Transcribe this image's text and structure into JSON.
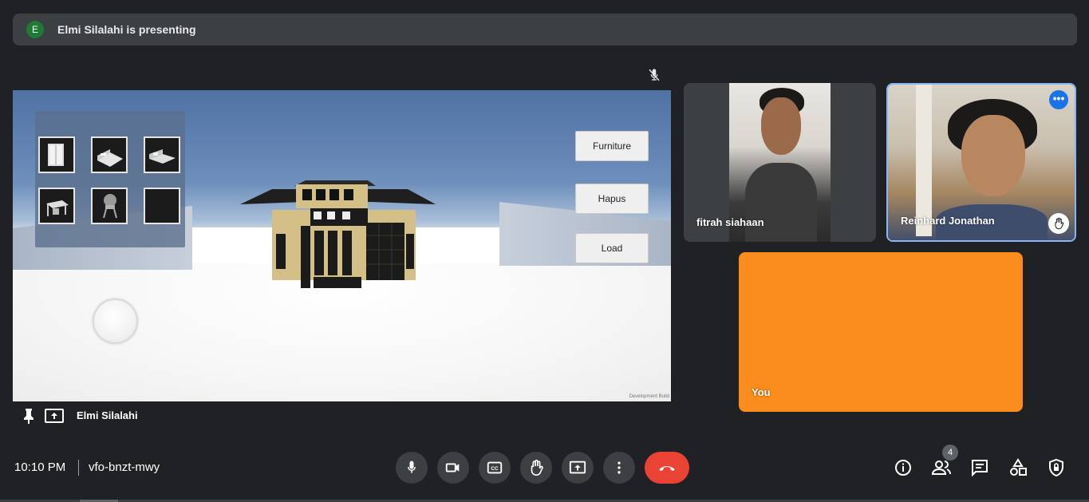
{
  "presenting_bar": {
    "avatar_initial": "E",
    "text": "Elmi Silalahi is presenting"
  },
  "stage": {
    "buttons": {
      "furniture": "Furniture",
      "hapus": "Hapus",
      "load": "Load"
    },
    "watermark": "Development Build",
    "presenter_name": "Elmi Silalahi"
  },
  "participants": [
    {
      "name": "fitrah siahaan"
    },
    {
      "name": "Reinhard Jonathan",
      "hand_raised": true
    },
    {
      "name": "You"
    }
  ],
  "bottom_bar": {
    "time": "10:10 PM",
    "meeting_code": "vfo-bnzt-mwy",
    "people_count": "4"
  },
  "colors": {
    "background": "#202124",
    "tile": "#3c4043",
    "you_tile": "#fa8c1e",
    "end_call": "#ea4335",
    "accent": "#1a73e8"
  },
  "icons": [
    "mic-icon",
    "camera-icon",
    "captions-icon",
    "raise-hand-icon",
    "present-screen-icon",
    "more-options-icon",
    "end-call-icon",
    "info-icon",
    "people-icon",
    "chat-icon",
    "activities-icon",
    "host-controls-icon",
    "pin-icon",
    "mic-off-icon"
  ]
}
